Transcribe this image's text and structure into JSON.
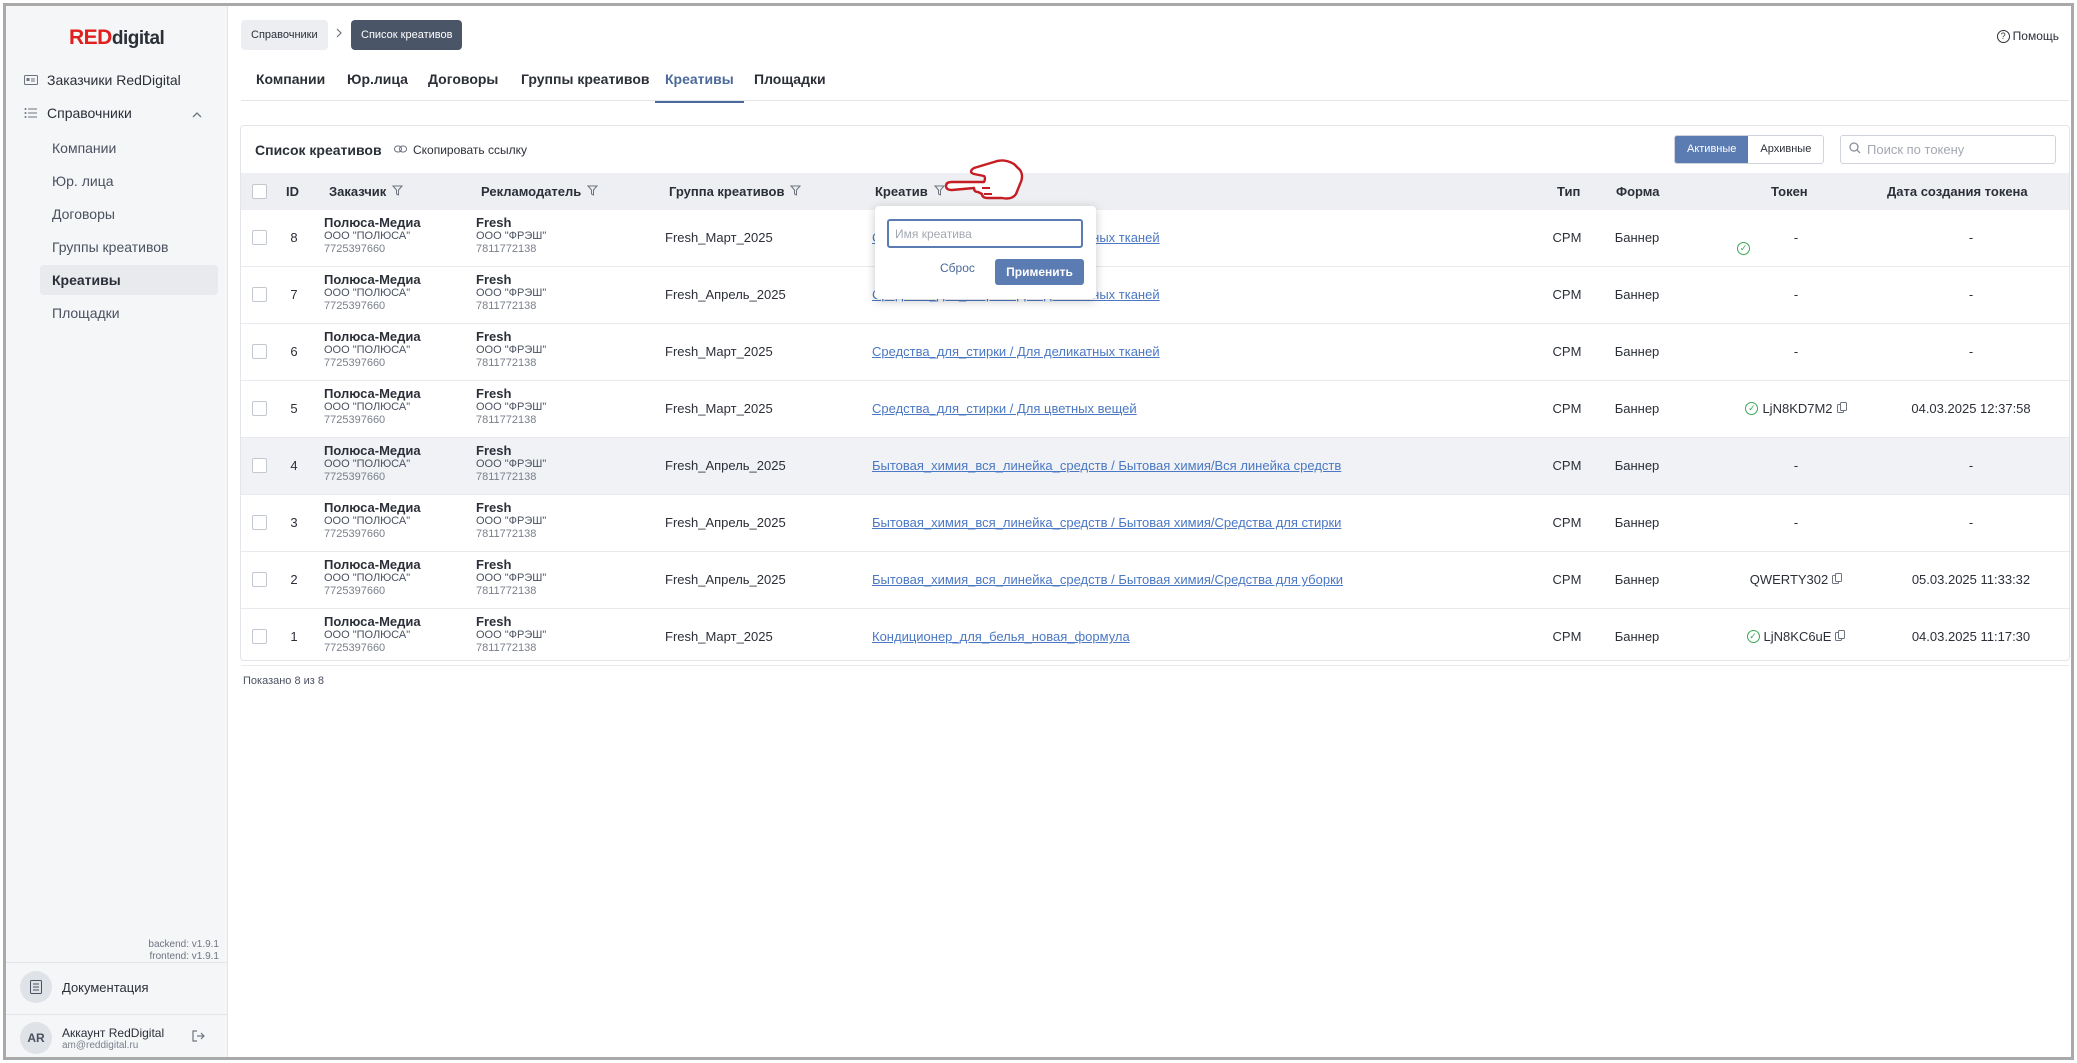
{
  "app": {
    "logo_red": "RED",
    "logo_dark": "digital",
    "help": "Помощь"
  },
  "sidebar": {
    "top_items": [
      {
        "label": "Заказчики RedDigital",
        "icon": "id-card-icon"
      },
      {
        "label": "Справочники",
        "icon": "list-icon"
      }
    ],
    "sub_items": [
      {
        "label": "Компании"
      },
      {
        "label": "Юр. лица"
      },
      {
        "label": "Договоры"
      },
      {
        "label": "Группы креативов"
      },
      {
        "label": "Креативы",
        "active": true
      },
      {
        "label": "Площадки"
      }
    ],
    "backend_version": "backend: v1.9.1",
    "frontend_version": "frontend: v1.9.1",
    "docs_label": "Документация",
    "account_initials": "AR",
    "account_name": "Аккаунт RedDigital",
    "account_email": "am@reddigital.ru"
  },
  "breadcrumb": {
    "parent": "Справочники",
    "current": "Список креативов"
  },
  "tabs": [
    "Компании",
    "Юр.лица",
    "Договоры",
    "Группы креативов",
    "Креативы",
    "Площадки"
  ],
  "active_tab": "Креативы",
  "table_toolbar": {
    "title": "Список креативов",
    "copy_link": "Скопировать ссылку",
    "segment_active": "Активные",
    "segment_archive": "Архивные",
    "search_placeholder": "Поиск по токену"
  },
  "columns": {
    "id": "ID",
    "customer": "Заказчик",
    "advertiser": "Рекламодатель",
    "group": "Группа креативов",
    "creative": "Креатив",
    "type": "Тип",
    "form": "Форма",
    "token": "Токен",
    "token_date": "Дата создания токена"
  },
  "rows": [
    {
      "id": "8",
      "cust_name": "Полюса-Медиа",
      "cust_legal": "ООО \"ПОЛЮСА\"",
      "cust_inn": "7725397660",
      "adv_name": "Fresh",
      "adv_legal": "ООО \"ФРЭШ\"",
      "adv_inn": "7811772138",
      "group": "Fresh_Март_2025",
      "creative": "Средства_для_стирки / Для деликатных тканей",
      "type": "CPM",
      "form": "Баннер",
      "token": "-",
      "token_date": "-"
    },
    {
      "id": "7",
      "cust_name": "Полюса-Медиа",
      "cust_legal": "ООО \"ПОЛЮСА\"",
      "cust_inn": "7725397660",
      "adv_name": "Fresh",
      "adv_legal": "ООО \"ФРЭШ\"",
      "adv_inn": "7811772138",
      "group": "Fresh_Апрель_2025",
      "creative": "Средства_для_стирки / Для деликатных тканей",
      "type": "CPM",
      "form": "Баннер",
      "token": "-",
      "token_date": "-"
    },
    {
      "id": "6",
      "cust_name": "Полюса-Медиа",
      "cust_legal": "ООО \"ПОЛЮСА\"",
      "cust_inn": "7725397660",
      "adv_name": "Fresh",
      "adv_legal": "ООО \"ФРЭШ\"",
      "adv_inn": "7811772138",
      "group": "Fresh_Март_2025",
      "creative": "Средства_для_стирки / Для деликатных тканей",
      "type": "CPM",
      "form": "Баннер",
      "token": "-",
      "token_date": "-"
    },
    {
      "id": "5",
      "cust_name": "Полюса-Медиа",
      "cust_legal": "ООО \"ПОЛЮСА\"",
      "cust_inn": "7725397660",
      "adv_name": "Fresh",
      "adv_legal": "ООО \"ФРЭШ\"",
      "adv_inn": "7811772138",
      "group": "Fresh_Март_2025",
      "creative": "Средства_для_стирки / Для цветных вещей",
      "type": "CPM",
      "form": "Баннер",
      "token": "LjN8KD7M2",
      "token_date": "04.03.2025 12:37:58"
    },
    {
      "id": "4",
      "cust_name": "Полюса-Медиа",
      "cust_legal": "ООО \"ПОЛЮСА\"",
      "cust_inn": "7725397660",
      "adv_name": "Fresh",
      "adv_legal": "ООО \"ФРЭШ\"",
      "adv_inn": "7811772138",
      "group": "Fresh_Апрель_2025",
      "creative": "Бытовая_химия_вся_линейка_средств / Бытовая химия/Вся линейка средств",
      "type": "CPM",
      "form": "Баннер",
      "token": "-",
      "token_date": "-"
    },
    {
      "id": "3",
      "cust_name": "Полюса-Медиа",
      "cust_legal": "ООО \"ПОЛЮСА\"",
      "cust_inn": "7725397660",
      "adv_name": "Fresh",
      "adv_legal": "ООО \"ФРЭШ\"",
      "adv_inn": "7811772138",
      "group": "Fresh_Апрель_2025",
      "creative": "Бытовая_химия_вся_линейка_средств / Бытовая химия/Средства для стирки",
      "type": "CPM",
      "form": "Баннер",
      "token": "-",
      "token_date": "-"
    },
    {
      "id": "2",
      "cust_name": "Полюса-Медиа",
      "cust_legal": "ООО \"ПОЛЮСА\"",
      "cust_inn": "7725397660",
      "adv_name": "Fresh",
      "adv_legal": "ООО \"ФРЭШ\"",
      "adv_inn": "7811772138",
      "group": "Fresh_Апрель_2025",
      "creative": "Бытовая_химия_вся_линейка_средств / Бытовая химия/Средства для уборки",
      "type": "CPM",
      "form": "Баннер",
      "token": "QWERTY302",
      "token_date": "05.03.2025 11:33:32"
    },
    {
      "id": "1",
      "cust_name": "Полюса-Медиа",
      "cust_legal": "ООО \"ПОЛЮСА\"",
      "cust_inn": "7725397660",
      "adv_name": "Fresh",
      "adv_legal": "ООО \"ФРЭШ\"",
      "adv_inn": "7811772138",
      "group": "Fresh_Март_2025",
      "creative": "Кондиционер_для_белья_новая_формула",
      "type": "CPM",
      "form": "Баннер",
      "token": "LjN8KC6uE",
      "token_date": "04.03.2025 11:17:30"
    }
  ],
  "footer_count": "Показано 8 из 8",
  "filter_popover": {
    "placeholder": "Имя креатива",
    "reset": "Сброс",
    "apply": "Применить"
  }
}
